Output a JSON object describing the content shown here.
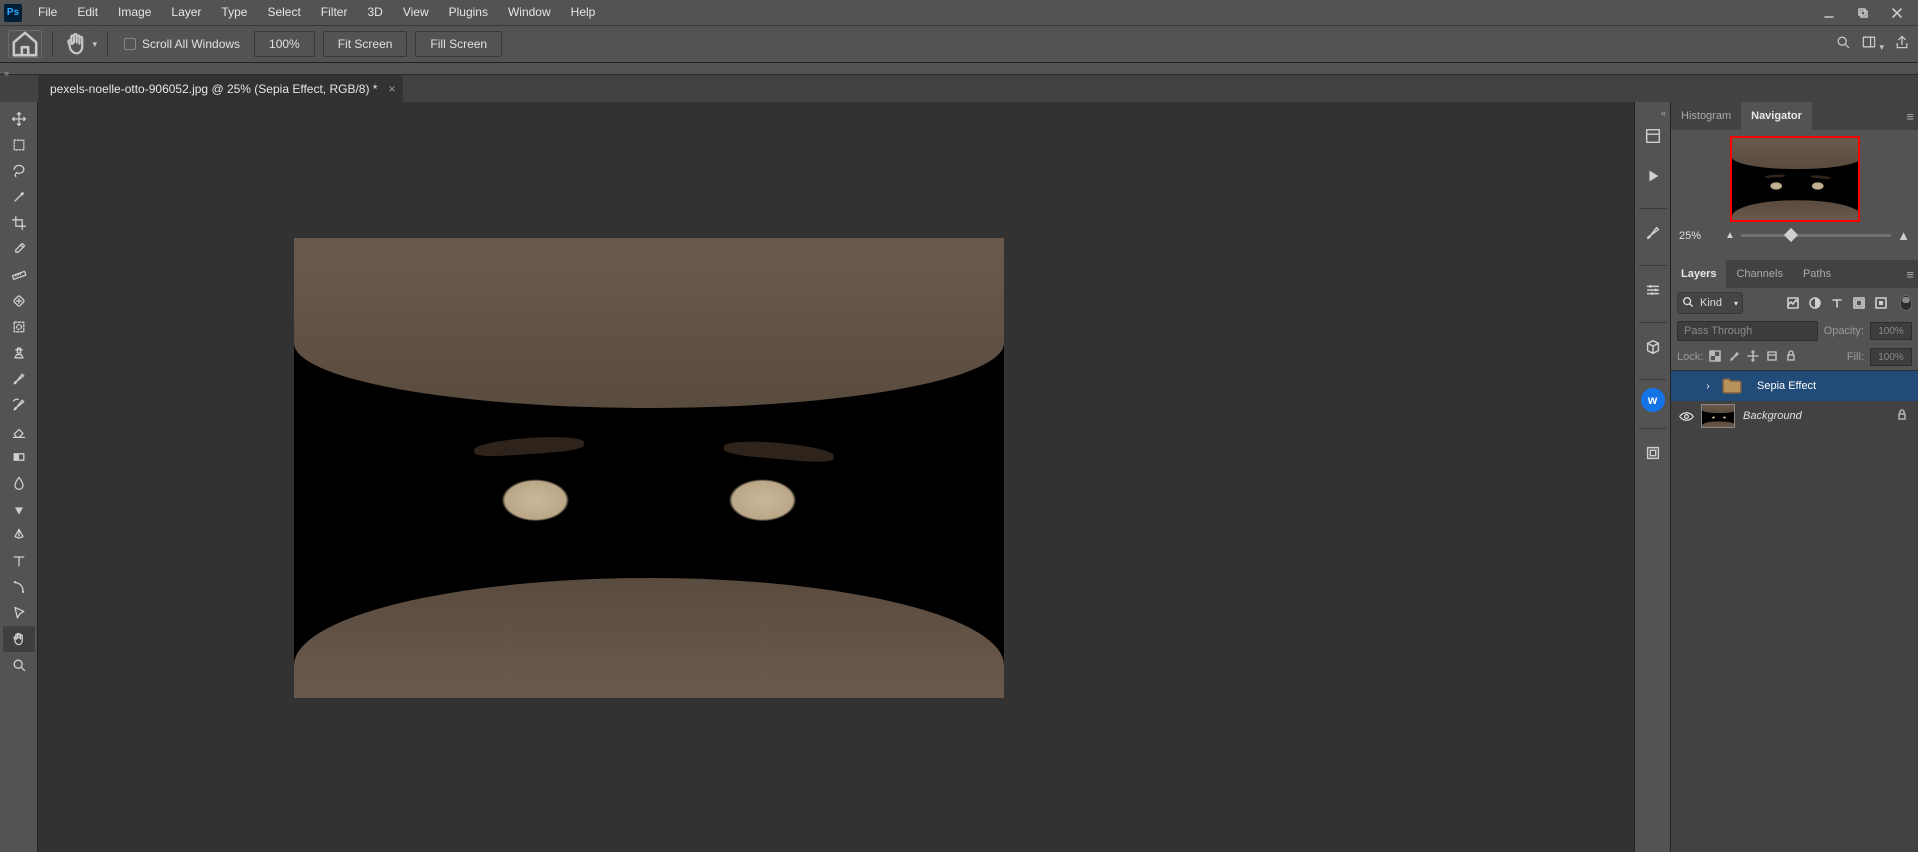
{
  "menu": {
    "items": [
      "File",
      "Edit",
      "Image",
      "Layer",
      "Type",
      "Select",
      "Filter",
      "3D",
      "View",
      "Plugins",
      "Window",
      "Help"
    ]
  },
  "options_bar": {
    "scroll_all_label": "Scroll All Windows",
    "zoom_value": "100%",
    "fit_screen": "Fit Screen",
    "fill_screen": "Fill Screen"
  },
  "document": {
    "tab_title": "pexels-noelle-otto-906052.jpg @ 25% (Sepia Effect, RGB/8) *"
  },
  "navigator_panel": {
    "tabs": [
      "Histogram",
      "Navigator"
    ],
    "active_tab": 1,
    "zoom_value": "25%"
  },
  "layers_panel": {
    "tabs": [
      "Layers",
      "Channels",
      "Paths"
    ],
    "active_tab": 0,
    "filter_kind": "Kind",
    "blend_mode": "Pass Through",
    "opacity_label": "Opacity:",
    "opacity_value": "100%",
    "lock_label": "Lock:",
    "fill_label": "Fill:",
    "fill_value": "100%",
    "layers": [
      {
        "name": "Sepia Effect",
        "type": "group",
        "visible": false,
        "selected": true,
        "locked": false
      },
      {
        "name": "Background",
        "type": "image",
        "visible": true,
        "selected": false,
        "locked": true
      }
    ]
  }
}
